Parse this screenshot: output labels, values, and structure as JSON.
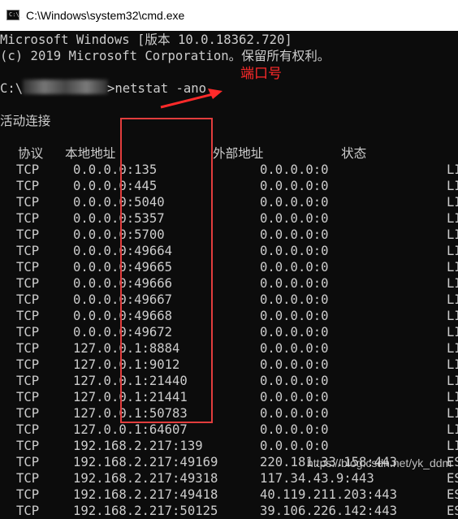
{
  "window": {
    "title": "C:\\Windows\\system32\\cmd.exe",
    "icon": "cmd-icon",
    "icon_glyph": "C:\\_"
  },
  "console": {
    "banner_line1": "Microsoft Windows [版本 10.0.18362.720]",
    "banner_line2": "(c) 2019 Microsoft Corporation。保留所有权利。",
    "prompt_prefix": "C:\\",
    "prompt_suffix": ">netstat -ano",
    "section_title": "活动连接",
    "headers": {
      "proto": "协议",
      "local": "本地地址",
      "foreign": "外部地址",
      "state": "状态"
    },
    "rows": [
      {
        "proto": "TCP",
        "local": "0.0.0.0:135",
        "foreign": "0.0.0.0:0",
        "state": "LI"
      },
      {
        "proto": "TCP",
        "local": "0.0.0.0:445",
        "foreign": "0.0.0.0:0",
        "state": "LI"
      },
      {
        "proto": "TCP",
        "local": "0.0.0.0:5040",
        "foreign": "0.0.0.0:0",
        "state": "LI"
      },
      {
        "proto": "TCP",
        "local": "0.0.0.0:5357",
        "foreign": "0.0.0.0:0",
        "state": "LI"
      },
      {
        "proto": "TCP",
        "local": "0.0.0.0:5700",
        "foreign": "0.0.0.0:0",
        "state": "LI"
      },
      {
        "proto": "TCP",
        "local": "0.0.0.0:49664",
        "foreign": "0.0.0.0:0",
        "state": "LI"
      },
      {
        "proto": "TCP",
        "local": "0.0.0.0:49665",
        "foreign": "0.0.0.0:0",
        "state": "LI"
      },
      {
        "proto": "TCP",
        "local": "0.0.0.0:49666",
        "foreign": "0.0.0.0:0",
        "state": "LI"
      },
      {
        "proto": "TCP",
        "local": "0.0.0.0:49667",
        "foreign": "0.0.0.0:0",
        "state": "LI"
      },
      {
        "proto": "TCP",
        "local": "0.0.0.0:49668",
        "foreign": "0.0.0.0:0",
        "state": "LI"
      },
      {
        "proto": "TCP",
        "local": "0.0.0.0:49672",
        "foreign": "0.0.0.0:0",
        "state": "LI"
      },
      {
        "proto": "TCP",
        "local": "127.0.0.1:8884",
        "foreign": "0.0.0.0:0",
        "state": "LI"
      },
      {
        "proto": "TCP",
        "local": "127.0.0.1:9012",
        "foreign": "0.0.0.0:0",
        "state": "LI"
      },
      {
        "proto": "TCP",
        "local": "127.0.0.1:21440",
        "foreign": "0.0.0.0:0",
        "state": "LI"
      },
      {
        "proto": "TCP",
        "local": "127.0.0.1:21441",
        "foreign": "0.0.0.0:0",
        "state": "LI"
      },
      {
        "proto": "TCP",
        "local": "127.0.0.1:50783",
        "foreign": "0.0.0.0:0",
        "state": "LI"
      },
      {
        "proto": "TCP",
        "local": "127.0.0.1:64607",
        "foreign": "0.0.0.0:0",
        "state": "LI"
      },
      {
        "proto": "TCP",
        "local": "192.168.2.217:139",
        "foreign": "0.0.0.0:0",
        "state": "LI"
      },
      {
        "proto": "TCP",
        "local": "192.168.2.217:49169",
        "foreign": "220.181.33.158:443",
        "state": "ES"
      },
      {
        "proto": "TCP",
        "local": "192.168.2.217:49318",
        "foreign": "117.34.43.9:443",
        "state": "ES"
      },
      {
        "proto": "TCP",
        "local": "192.168.2.217:49418",
        "foreign": "40.119.211.203:443",
        "state": "ES"
      },
      {
        "proto": "TCP",
        "local": "192.168.2.217:50125",
        "foreign": "39.106.226.142:443",
        "state": "ES"
      }
    ]
  },
  "annotation": {
    "label": "端口号",
    "color": "#ff2a2a",
    "box_color": "#e23d3d"
  },
  "watermark": "https://blog.csdn.net/yk_ddm"
}
